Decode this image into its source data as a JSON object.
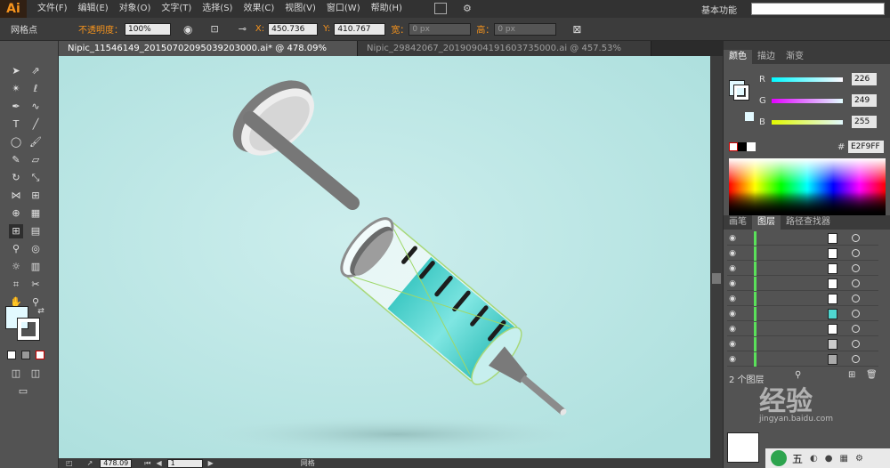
{
  "app": {
    "logo": "Ai"
  },
  "menu": [
    "文件(F)",
    "编辑(E)",
    "对象(O)",
    "文字(T)",
    "选择(S)",
    "效果(C)",
    "视图(V)",
    "窗口(W)",
    "帮助(H)"
  ],
  "menubar_right": {
    "workspace": "基本功能"
  },
  "control": {
    "label": "网格点",
    "opacity_label": "不透明度：",
    "opacity_value": "100%",
    "x_label": "X:",
    "x_value": "450.736",
    "y_label": "Y:",
    "y_value": "410.767",
    "w_label": "宽：",
    "w_value": "0 px",
    "h_label": "高：",
    "h_value": "0 px"
  },
  "tabs": [
    {
      "label": "Nipic_11546149_20150702095039203000.ai* @ 478.09% (RGB/预览)",
      "active": true
    },
    {
      "label": "Nipic_29842067_20190904191603735000.ai @ 457.53% (RGB/预览)",
      "active": false
    }
  ],
  "color_panel": {
    "tabs": [
      "颜色",
      "描边",
      "渐变"
    ],
    "r_label": "R",
    "r_value": "226",
    "g_label": "G",
    "g_value": "249",
    "b_label": "B",
    "b_value": "255",
    "hex": "E2F9FF",
    "fill_color": "#E2F9FF"
  },
  "layers_panel": {
    "tabs": [
      "画笔",
      "图层",
      "路径查找器"
    ],
    "count": "2 个图层",
    "rows": 9
  },
  "status": {
    "zoom": "478.09",
    "page": "1",
    "tool_name": "网格"
  },
  "watermark": {
    "text": "经验",
    "sub": "jingyan.baidu.com"
  },
  "taskbar": {
    "ime": "五"
  },
  "colors": {
    "canvas_bg": "#BFE7E6",
    "liquid": "#4FD6D0",
    "accent_orange": "#F7941D"
  }
}
